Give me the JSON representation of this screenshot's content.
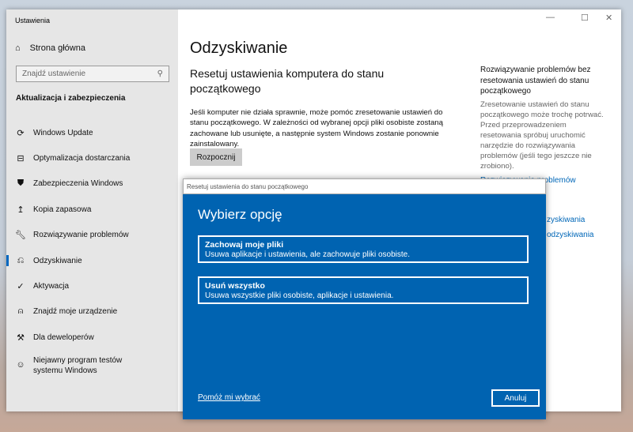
{
  "window": {
    "title": "Ustawienia",
    "minimize_icon": "minimize-icon",
    "maximize_icon": "maximize-icon",
    "close_icon": "close-icon"
  },
  "sidebar": {
    "home": "Strona główna",
    "search_placeholder": "Znajdź ustawienie",
    "section": "Aktualizacja i zabezpieczenia",
    "items": [
      {
        "label": "Windows Update",
        "icon": "refresh-icon"
      },
      {
        "label": "Optymalizacja dostarczania",
        "icon": "delivery-icon"
      },
      {
        "label": "Zabezpieczenia Windows",
        "icon": "shield-icon"
      },
      {
        "label": "Kopia zapasowa",
        "icon": "backup-icon"
      },
      {
        "label": "Rozwiązywanie problemów",
        "icon": "wrench-icon"
      },
      {
        "label": "Odzyskiwanie",
        "icon": "recovery-icon",
        "selected": true
      },
      {
        "label": "Aktywacja",
        "icon": "check-circle-icon"
      },
      {
        "label": "Znajdź moje urządzenie",
        "icon": "find-device-icon"
      },
      {
        "label": "Dla deweloperów",
        "icon": "developer-icon"
      },
      {
        "label": "Niejawny program testów systemu Windows",
        "icon": "insider-icon"
      }
    ]
  },
  "main": {
    "title": "Odzyskiwanie",
    "reset_heading": "Resetuj ustawienia komputera do stanu początkowego",
    "reset_desc": "Jeśli komputer nie działa sprawnie, może pomóc zresetowanie ustawień do stanu początkowego. W zależności od wybranej opcji pliki osobiste zostaną zachowane lub usunięte, a następnie system Windows zostanie ponownie zainstalowany.",
    "start_button": "Rozpocznij"
  },
  "right_panel": {
    "title": "Rozwiązywanie problemów bez resetowania ustawień do stanu początkowego",
    "desc": "Zresetowanie ustawień do stanu początkowego może trochę potrwać. Przed przeprowadzeniem resetowania spróbuj uruchomić narzędzie do rozwiązywania problemów (jeśli tego jeszcze nie zrobiono).",
    "link": "Rozwiązywanie problemów",
    "partial_link_1": "zyskiwania",
    "partial_link_2": "odzyskiwania"
  },
  "dialog": {
    "title": "Resetuj ustawienia do stanu początkowego",
    "heading": "Wybierz opcję",
    "options": [
      {
        "title": "Zachowaj moje pliki",
        "desc": "Usuwa aplikacje i ustawienia, ale zachowuje pliki osobiste."
      },
      {
        "title": "Usuń wszystko",
        "desc": "Usuwa wszystkie pliki osobiste, aplikacje i ustawienia."
      }
    ],
    "help_link": "Pomóż mi wybrać",
    "cancel": "Anuluj",
    "accent": "#0063b1"
  }
}
